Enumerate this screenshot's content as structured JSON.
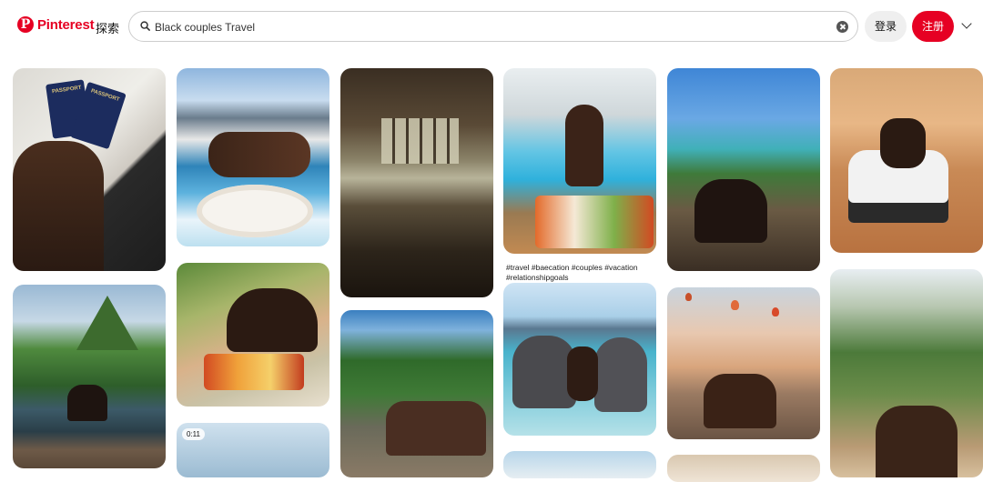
{
  "header": {
    "logo_text": "Pinterest",
    "explore": "探索",
    "search_value": "Black couples Travel",
    "login": "登录",
    "signup": "注册"
  },
  "pins": {
    "caption": "#travel #baecation #couples #vacation #relationshipgoals",
    "video_duration": "0:11",
    "passport_text": "PASSPORT"
  },
  "colors": {
    "brand": "#e60023"
  }
}
